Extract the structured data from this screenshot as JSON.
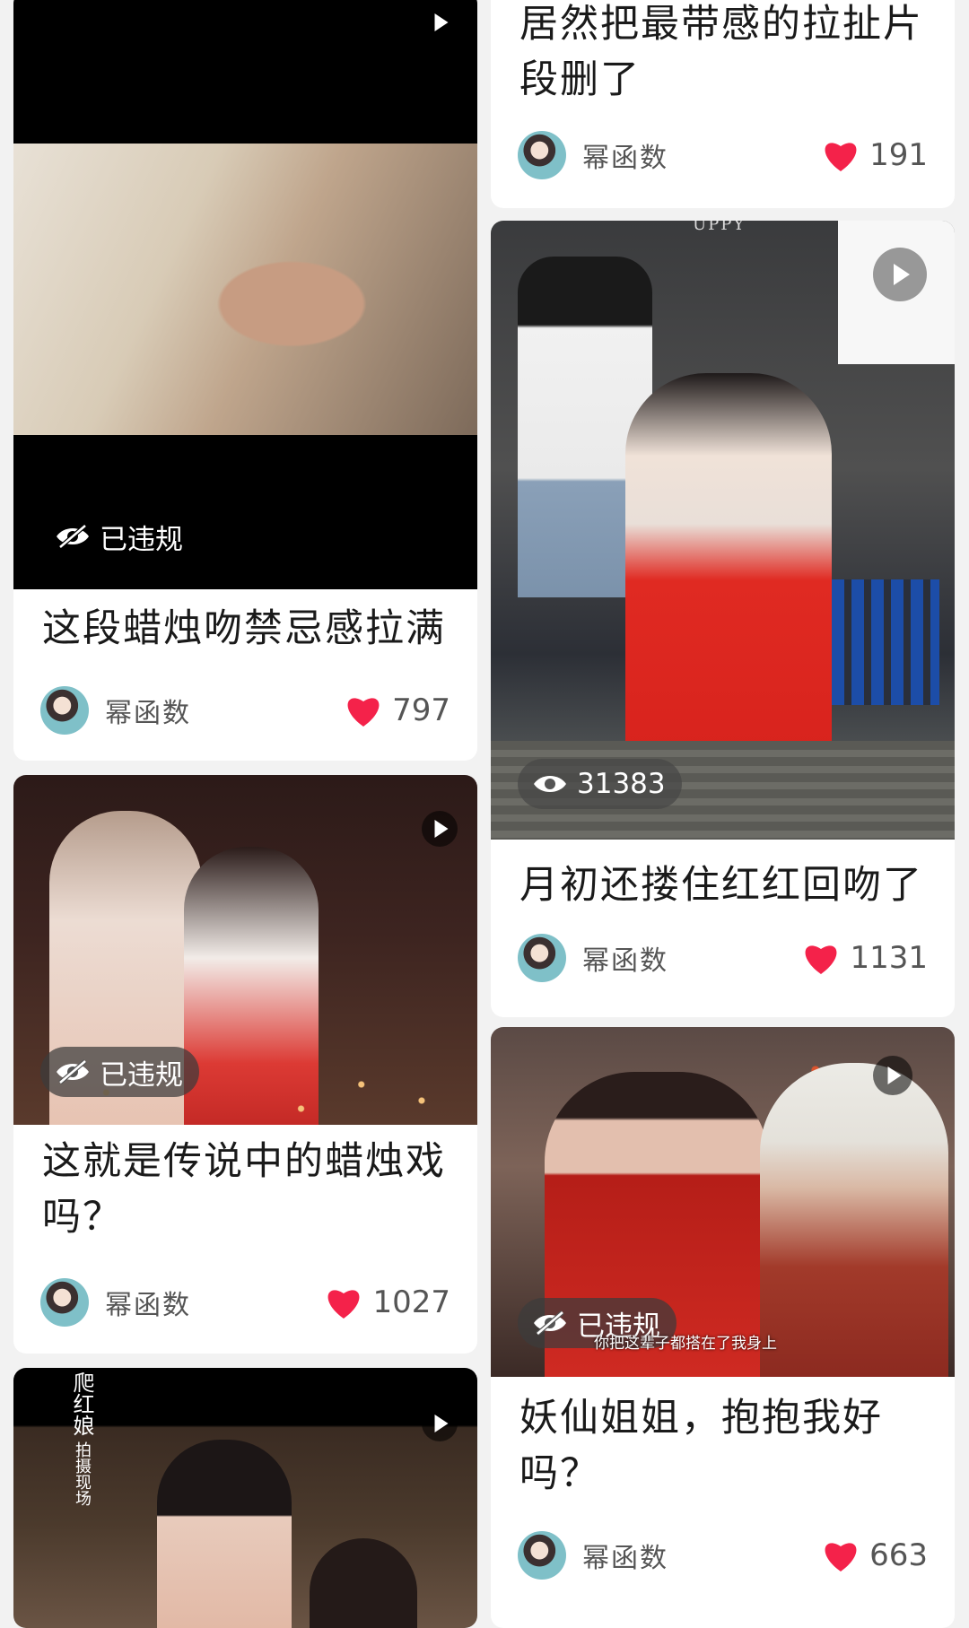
{
  "colors": {
    "accent_heart": "#f4224a",
    "card_bg": "#ffffff",
    "page_bg": "#f2f2f2"
  },
  "icons": {
    "play": "play-icon",
    "hidden": "eye-slash-icon",
    "views": "eye-icon",
    "like": "heart-icon"
  },
  "left_column": [
    {
      "title": "这段蜡烛吻禁忌感拉满",
      "status": "已违规",
      "author": "幂函数",
      "likes": "797"
    },
    {
      "title": "这就是传说中的蜡烛戏吗？",
      "status": "已违规",
      "author": "幂函数",
      "likes": "1027"
    },
    {
      "thumb_text": "爬红娘",
      "thumb_subtext": "拍摄现场"
    }
  ],
  "right_column": [
    {
      "title": "居然把最带感的拉扯片段删了",
      "author": "幂函数",
      "likes": "191"
    },
    {
      "title": "月初还搂住红红回吻了",
      "views": "31383",
      "author": "幂函数",
      "likes": "1131",
      "thumb_watermark": "UPPY"
    },
    {
      "title": "妖仙姐姐，抱抱我好吗？",
      "status": "已违规",
      "author": "幂函数",
      "likes": "663",
      "subtitle": "你把这辈子都搭在了我身上"
    }
  ]
}
